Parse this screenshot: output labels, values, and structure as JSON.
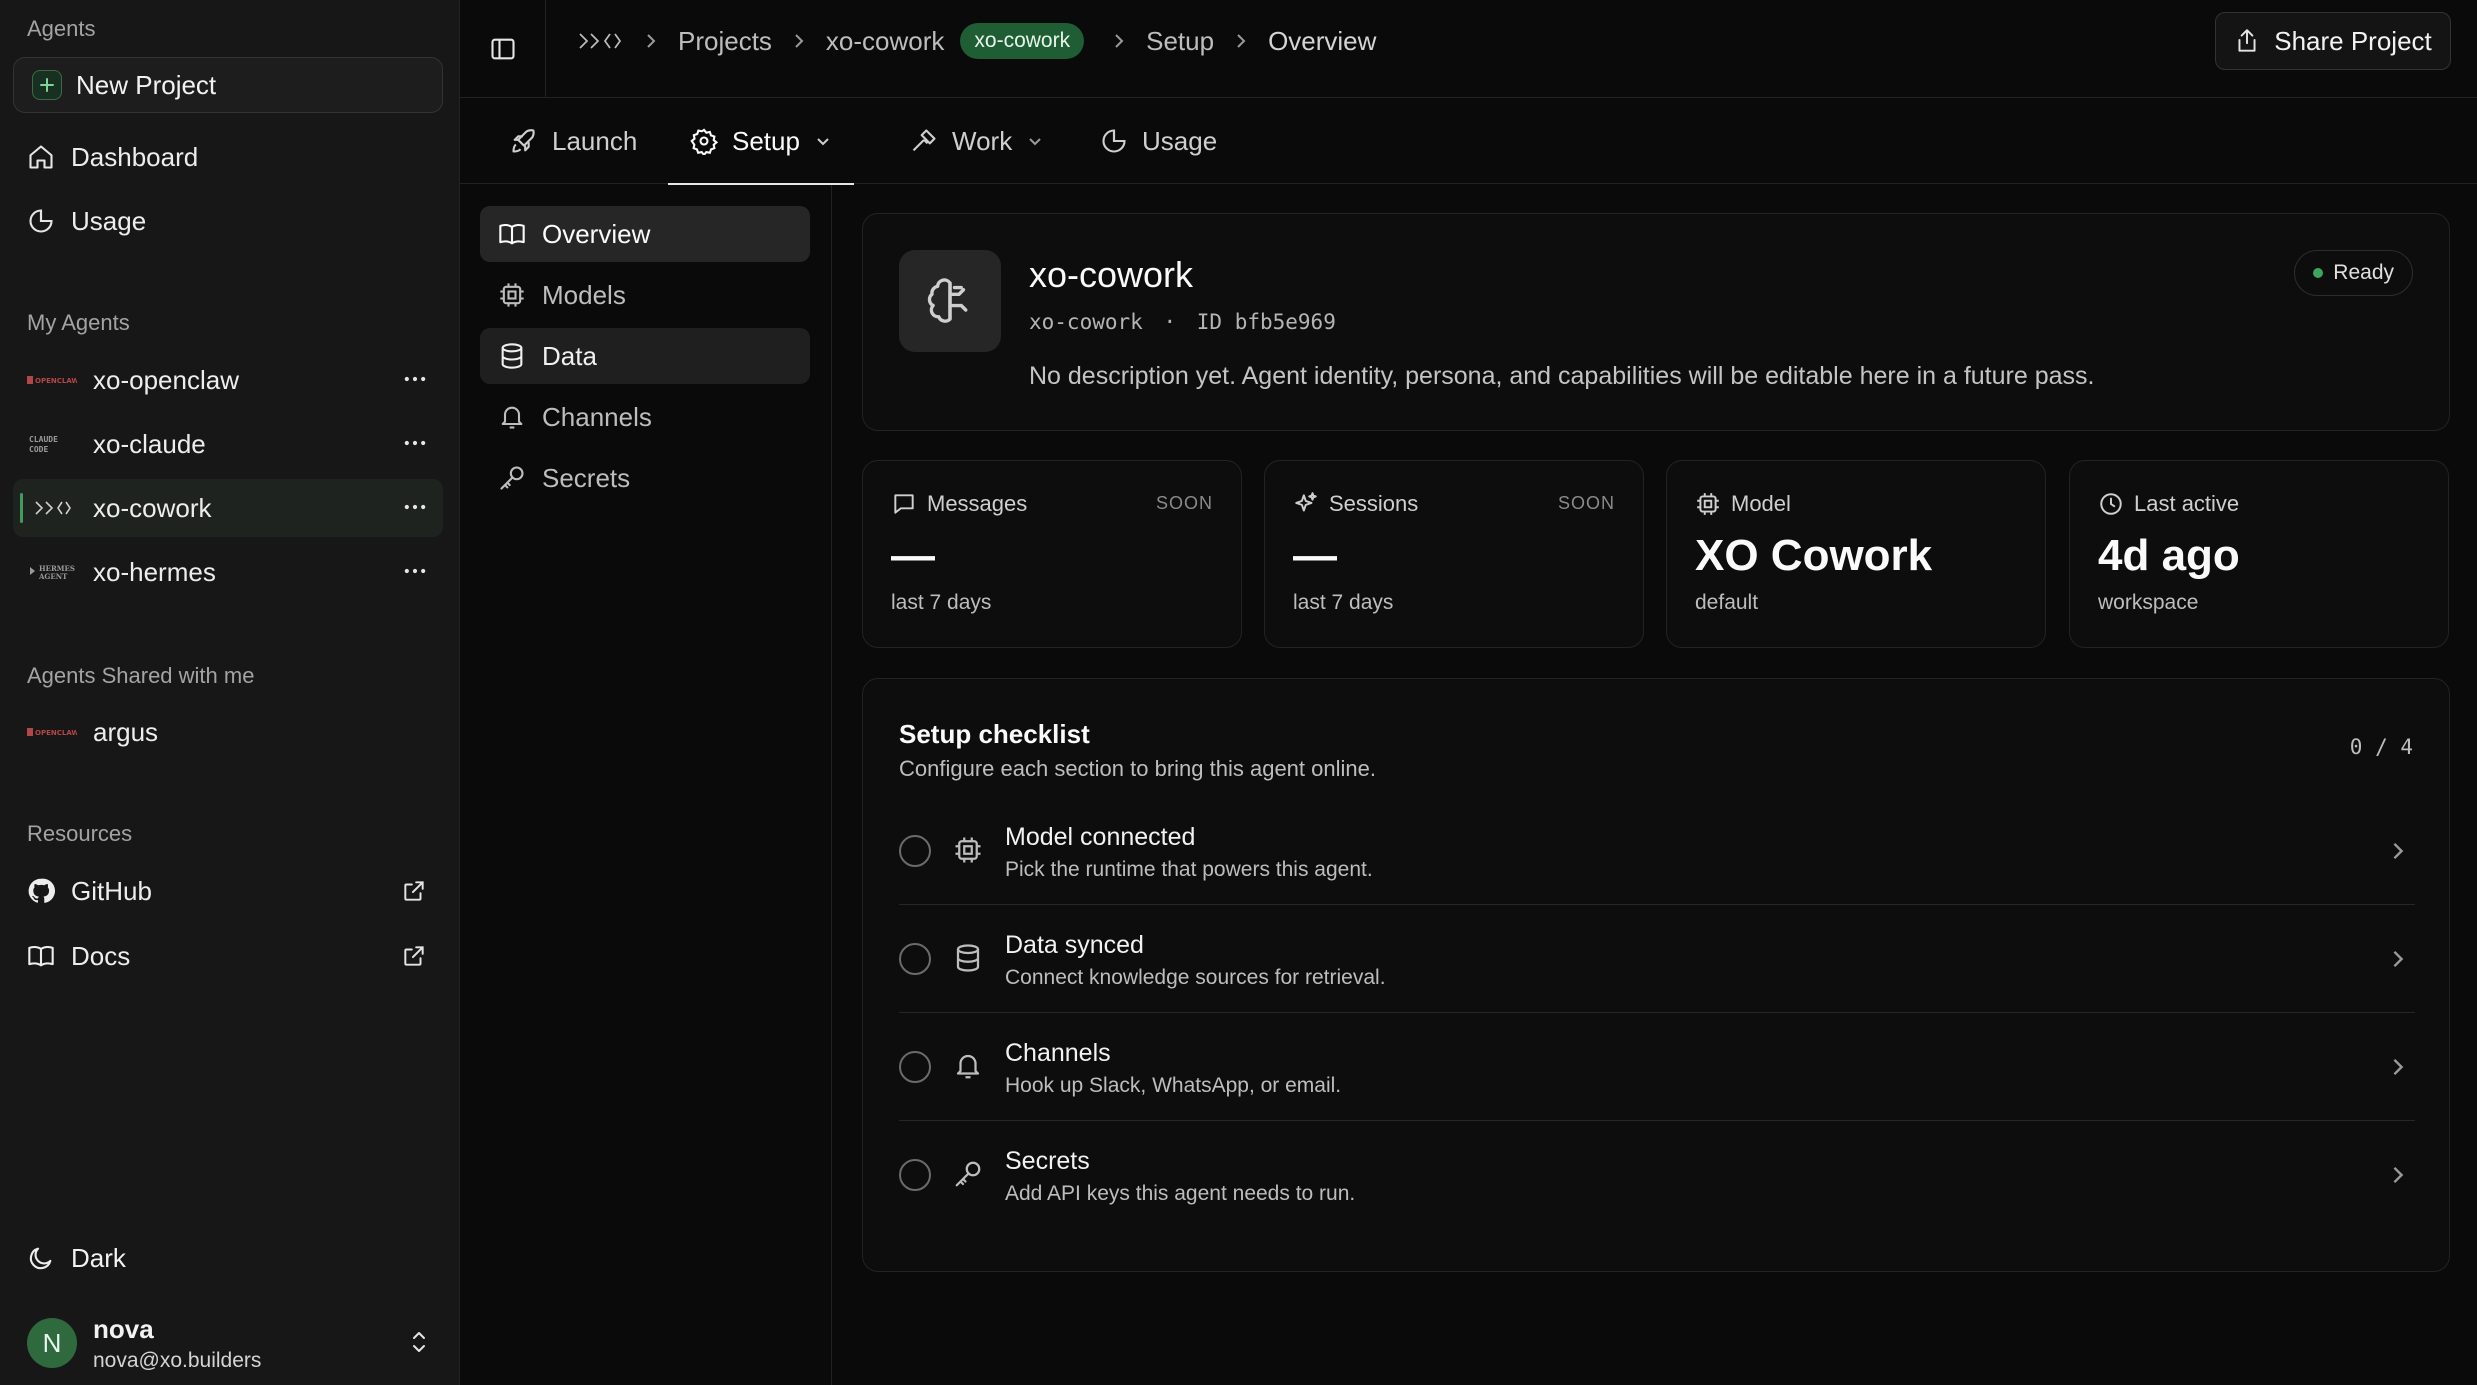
{
  "sidebar": {
    "agents_title": "Agents",
    "new_project": "New Project",
    "nav": [
      {
        "label": "Dashboard",
        "icon": "home-icon"
      },
      {
        "label": "Usage",
        "icon": "pie-chart-icon"
      }
    ],
    "my_agents_title": "My Agents",
    "my_agents": [
      {
        "label": "xo-openclaw",
        "logo": "OPENCLAW"
      },
      {
        "label": "xo-claude",
        "logo": "CLAUDE CODE"
      },
      {
        "label": "xo-cowork",
        "logo": "xo-logo"
      },
      {
        "label": "xo-hermes",
        "logo": "HERMES AGENT"
      }
    ],
    "shared_title": "Agents Shared with me",
    "shared_agents": [
      {
        "label": "argus",
        "logo": "OPENCLAW"
      }
    ],
    "resources_title": "Resources",
    "resources": [
      {
        "label": "GitHub",
        "icon": "github-icon"
      },
      {
        "label": "Docs",
        "icon": "book-icon"
      }
    ],
    "theme_label": "Dark",
    "user": {
      "initial": "N",
      "name": "nova",
      "email": "nova@xo.builders"
    }
  },
  "topbar": {
    "breadcrumbs": [
      "Projects",
      "xo-cowork",
      "Setup",
      "Overview"
    ],
    "project_badge": "xo-cowork",
    "share_label": "Share Project"
  },
  "tabs": [
    {
      "label": "Launch",
      "icon": "rocket-icon"
    },
    {
      "label": "Setup",
      "icon": "gear-icon",
      "active": true
    },
    {
      "label": "Work",
      "icon": "hammer-icon"
    },
    {
      "label": "Usage",
      "icon": "pie-chart-icon"
    }
  ],
  "subnav": [
    {
      "label": "Overview",
      "icon": "book-icon",
      "active": true
    },
    {
      "label": "Models",
      "icon": "cpu-icon"
    },
    {
      "label": "Data",
      "icon": "database-icon"
    },
    {
      "label": "Channels",
      "icon": "bell-icon"
    },
    {
      "label": "Secrets",
      "icon": "key-icon"
    }
  ],
  "agent": {
    "name": "xo-cowork",
    "slug": "xo-cowork",
    "separator": "·",
    "id_label": "ID bfb5e969",
    "description": "No description yet. Agent identity, persona, and capabilities will be editable here in a future pass.",
    "status": "Ready",
    "status_color": "#3ba55c"
  },
  "stats": [
    {
      "label": "Messages",
      "badge": "SOON",
      "value": "—",
      "sub": "last 7 days",
      "icon": "message-icon"
    },
    {
      "label": "Sessions",
      "badge": "SOON",
      "value": "—",
      "sub": "last 7 days",
      "icon": "sparkles-icon"
    },
    {
      "label": "Model",
      "badge": "",
      "value": "XO Cowork",
      "sub": "default",
      "icon": "cpu-icon"
    },
    {
      "label": "Last active",
      "badge": "",
      "value": "4d ago",
      "sub": "workspace",
      "icon": "clock-icon"
    }
  ],
  "checklist": {
    "title": "Setup checklist",
    "subtitle": "Configure each section to bring this agent online.",
    "count": "0 / 4",
    "items": [
      {
        "title": "Model connected",
        "desc": "Pick the runtime that powers this agent.",
        "icon": "cpu-icon"
      },
      {
        "title": "Data synced",
        "desc": "Connect knowledge sources for retrieval.",
        "icon": "database-icon"
      },
      {
        "title": "Channels",
        "desc": "Hook up Slack, WhatsApp, or email.",
        "icon": "bell-icon"
      },
      {
        "title": "Secrets",
        "desc": "Add API keys this agent needs to run.",
        "icon": "key-icon"
      }
    ]
  },
  "colors": {
    "accent_green": "#1f5e34",
    "background": "#0a0a0a",
    "sidebar": "#171717"
  }
}
